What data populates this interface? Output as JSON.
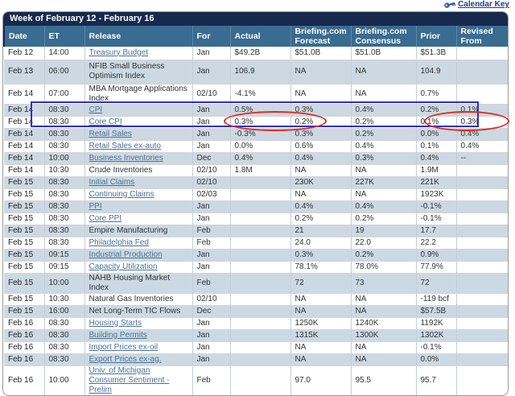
{
  "header": {
    "calendar_key_label": "Calendar Key",
    "week_title": "Week of February 12 - February 16"
  },
  "colors": {
    "title_band": "#17294D",
    "header_row": "#3A6B90",
    "row_shade": "#CCD9E3",
    "link": "#4A7296",
    "key_link": "#1B3C8C",
    "box_color": "#2B2FD0",
    "circle_color": "#E02B20"
  },
  "table": {
    "columns": [
      "Date",
      "ET",
      "Release",
      "For",
      "Actual",
      "Briefing.com Forecast",
      "Briefing.com Consensus",
      "Prior",
      "Revised From"
    ],
    "rows": [
      {
        "date": "Feb 12",
        "et": "14:00",
        "release": "Treasury Budget",
        "link": true,
        "for": "Jan",
        "actual": "$49.2B",
        "forecast": "$51.0B",
        "consensus": "$51.0B",
        "prior": "$51.3B",
        "revised": ""
      },
      {
        "date": "Feb 13",
        "et": "06:00",
        "release": "NFIB Small Business Optimism Index",
        "link": false,
        "for": "Jan",
        "actual": "106.9",
        "forecast": "NA",
        "consensus": "NA",
        "prior": "104.9",
        "revised": ""
      },
      {
        "date": "Feb 14",
        "et": "07:00",
        "release": "MBA Mortgage Applications Index",
        "link": false,
        "for": "02/10",
        "actual": "-4.1%",
        "forecast": "NA",
        "consensus": "NA",
        "prior": "0.7%",
        "revised": ""
      },
      {
        "date": "Feb 14",
        "et": "08:30",
        "release": "CPI",
        "link": true,
        "for": "Jan",
        "actual": "0.5%",
        "forecast": "0.3%",
        "consensus": "0.4%",
        "prior": "0.2%",
        "revised": "0.1%"
      },
      {
        "date": "Feb 14",
        "et": "08:30",
        "release": "Core CPI",
        "link": true,
        "for": "Jan",
        "actual": "0.3%",
        "forecast": "0.2%",
        "consensus": "0.2%",
        "prior": "0.1%",
        "revised": "0.3%"
      },
      {
        "date": "Feb 14",
        "et": "08:30",
        "release": "Retail Sales",
        "link": true,
        "for": "Jan",
        "actual": "-0.3%",
        "forecast": "0.3%",
        "consensus": "0.2%",
        "prior": "0.0%",
        "revised": "0.4%"
      },
      {
        "date": "Feb 14",
        "et": "08:30",
        "release": "Retail Sales ex-auto",
        "link": true,
        "for": "Jan",
        "actual": "0.0%",
        "forecast": "0.6%",
        "consensus": "0.4%",
        "prior": "0.1%",
        "revised": "0.4%"
      },
      {
        "date": "Feb 14",
        "et": "10:00",
        "release": "Business Inventories",
        "link": true,
        "for": "Dec",
        "actual": "0.4%",
        "forecast": "0.4%",
        "consensus": "0.3%",
        "prior": "0.4%",
        "revised": "--"
      },
      {
        "date": "Feb 14",
        "et": "10:30",
        "release": "Crude Inventories",
        "link": false,
        "for": "02/10",
        "actual": "1.8M",
        "forecast": "NA",
        "consensus": "NA",
        "prior": "1.9M",
        "revised": ""
      },
      {
        "date": "Feb 15",
        "et": "08:30",
        "release": "Initial Claims",
        "link": true,
        "for": "02/10",
        "actual": "",
        "forecast": "230K",
        "consensus": "227K",
        "prior": "221K",
        "revised": ""
      },
      {
        "date": "Feb 15",
        "et": "08:30",
        "release": "Continuing Claims",
        "link": true,
        "for": "02/03",
        "actual": "",
        "forecast": "NA",
        "consensus": "NA",
        "prior": "1923K",
        "revised": ""
      },
      {
        "date": "Feb 15",
        "et": "08:30",
        "release": "PPI",
        "link": true,
        "for": "Jan",
        "actual": "",
        "forecast": "0.4%",
        "consensus": "0.4%",
        "prior": "-0.1%",
        "revised": ""
      },
      {
        "date": "Feb 15",
        "et": "08:30",
        "release": "Core PPI",
        "link": true,
        "for": "Jan",
        "actual": "",
        "forecast": "0.2%",
        "consensus": "0.2%",
        "prior": "-0.1%",
        "revised": ""
      },
      {
        "date": "Feb 15",
        "et": "08:30",
        "release": "Empire Manufacturing",
        "link": false,
        "for": "Feb",
        "actual": "",
        "forecast": "21",
        "consensus": "19",
        "prior": "17.7",
        "revised": ""
      },
      {
        "date": "Feb 15",
        "et": "08:30",
        "release": "Philadelphia Fed",
        "link": true,
        "for": "Feb",
        "actual": "",
        "forecast": "24.0",
        "consensus": "22.0",
        "prior": "22.2",
        "revised": ""
      },
      {
        "date": "Feb 15",
        "et": "09:15",
        "release": "Industrial Production",
        "link": true,
        "for": "Jan",
        "actual": "",
        "forecast": "0.3%",
        "consensus": "0.2%",
        "prior": "0.9%",
        "revised": ""
      },
      {
        "date": "Feb 15",
        "et": "09:15",
        "release": "Capacity Utilization",
        "link": true,
        "for": "Jan",
        "actual": "",
        "forecast": "78.1%",
        "consensus": "78.0%",
        "prior": "77.9%",
        "revised": ""
      },
      {
        "date": "Feb 15",
        "et": "10:00",
        "release": "NAHB Housing Market Index",
        "link": false,
        "for": "Feb",
        "actual": "",
        "forecast": "72",
        "consensus": "73",
        "prior": "72",
        "revised": ""
      },
      {
        "date": "Feb 15",
        "et": "10:30",
        "release": "Natural Gas Inventories",
        "link": false,
        "for": "02/10",
        "actual": "",
        "forecast": "NA",
        "consensus": "NA",
        "prior": "-119 bcf",
        "revised": ""
      },
      {
        "date": "Feb 15",
        "et": "16:00",
        "release": "Net Long-Term TIC Flows",
        "link": false,
        "for": "Dec",
        "actual": "",
        "forecast": "NA",
        "consensus": "NA",
        "prior": "$57.5B",
        "revised": ""
      },
      {
        "date": "Feb 16",
        "et": "08:30",
        "release": "Housing Starts",
        "link": true,
        "for": "Jan",
        "actual": "",
        "forecast": "1250K",
        "consensus": "1240K",
        "prior": "1192K",
        "revised": ""
      },
      {
        "date": "Feb 16",
        "et": "08:30",
        "release": "Building Permits",
        "link": true,
        "for": "Jan",
        "actual": "",
        "forecast": "1315K",
        "consensus": "1300K",
        "prior": "1302K",
        "revised": ""
      },
      {
        "date": "Feb 16",
        "et": "08:30",
        "release": "Import Prices ex-oil",
        "link": true,
        "for": "Jan",
        "actual": "",
        "forecast": "NA",
        "consensus": "NA",
        "prior": "-0.1%",
        "revised": ""
      },
      {
        "date": "Feb 16",
        "et": "08:30",
        "release": "Export Prices ex-ag.",
        "link": true,
        "for": "Jan",
        "actual": "",
        "forecast": "NA",
        "consensus": "NA",
        "prior": "0.0%",
        "revised": ""
      },
      {
        "date": "Feb 16",
        "et": "10:00",
        "release": "Univ. of Michigan Consumer Sentiment - Prelim",
        "link": true,
        "for": "Feb",
        "actual": "",
        "forecast": "97.0",
        "consensus": "95.5",
        "prior": "95.7",
        "revised": ""
      }
    ]
  },
  "annotations": {
    "box_marks": "CPI and Core CPI rows",
    "circle1_marks": "Core CPI Actual and Briefing.com Forecast values",
    "circle2_marks": "Core CPI Prior and Revised From values"
  }
}
